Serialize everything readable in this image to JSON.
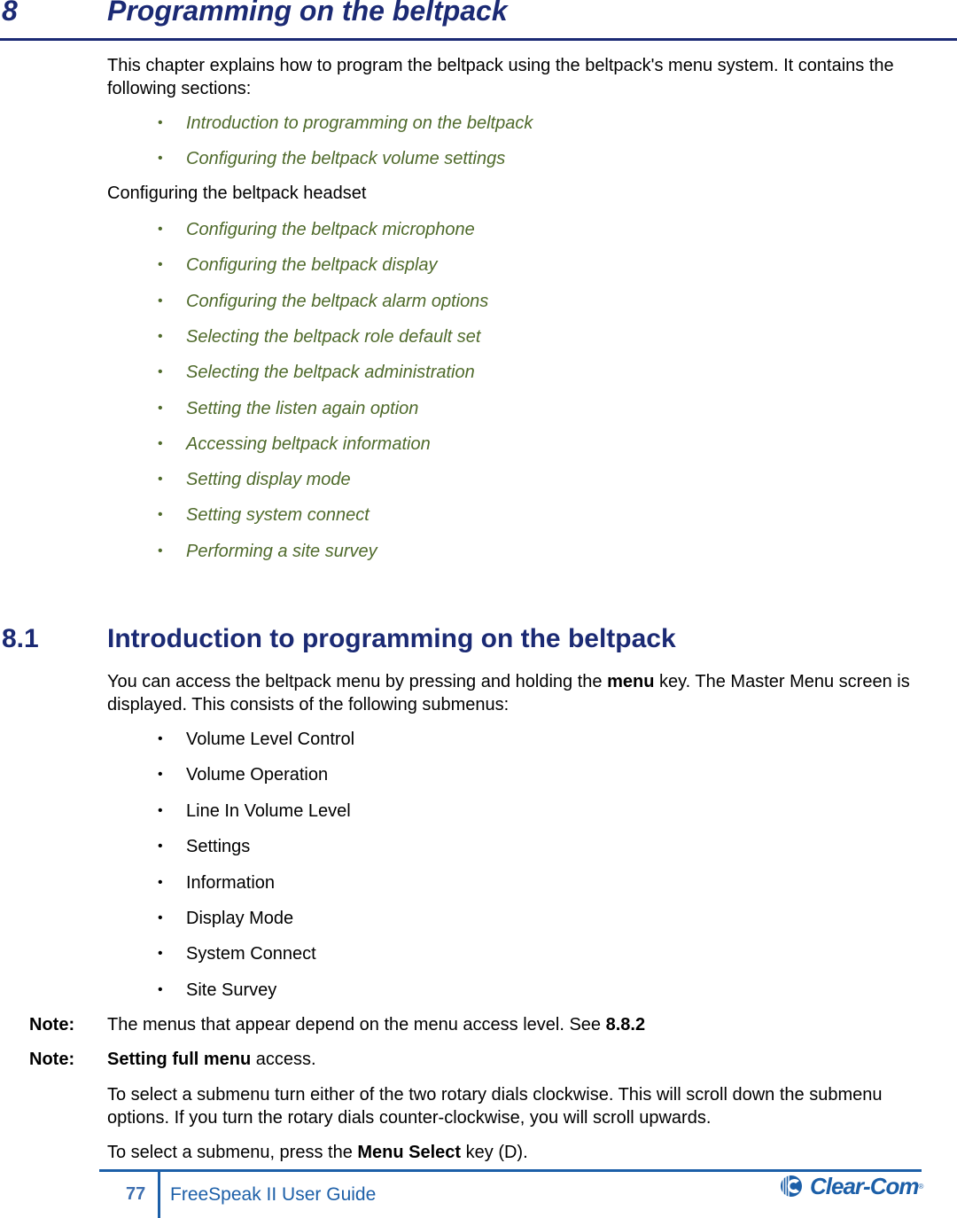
{
  "chapter": {
    "number": "8",
    "title": "Programming on the beltpack",
    "intro": "This chapter explains how to program the beltpack using the beltpack's menu system. It contains the following sections:",
    "sections_a": [
      "Introduction to programming on the beltpack",
      "Configuring the beltpack volume settings"
    ],
    "plain_line": "Configuring the beltpack headset",
    "sections_b": [
      "Configuring the beltpack microphone",
      "Configuring the beltpack display",
      "Configuring the beltpack alarm options",
      "Selecting the beltpack role default set",
      "Selecting the beltpack administration",
      "Setting the listen again option",
      "Accessing beltpack information",
      "Setting display mode",
      "Setting system connect",
      "Performing a site survey"
    ]
  },
  "section": {
    "number": "8.1",
    "title": "Introduction to programming on the beltpack",
    "para1_before": "You can access the beltpack menu by pressing and holding the ",
    "para1_bold": "menu",
    "para1_after": " key. The Master Menu screen is displayed. This consists of the following submenus:",
    "submenus": [
      "Volume Level Control",
      "Volume Operation",
      "Line In Volume Level",
      "Settings",
      "Information",
      "Display Mode",
      "System Connect",
      "Site Survey"
    ],
    "note_label": "Note:",
    "note1_text": "The menus that appear depend on the menu access level. See ",
    "note1_bold": "8.8.2",
    "note2_bold": "Setting full menu",
    "note2_text": " access.",
    "para2": "To select a submenu turn either of the two rotary dials clockwise. This will scroll down the submenu options. If you turn the rotary dials counter-clockwise, you will scroll upwards.",
    "para3_before": "To select a submenu, press the ",
    "para3_bold": "Menu Select",
    "para3_after": " key (D).",
    "bullet_glyph": "•"
  },
  "footer": {
    "page_number": "77",
    "guide_title": "FreeSpeak II User Guide",
    "logo_text": "Clear-Com",
    "logo_reg": "®"
  },
  "colors": {
    "heading": "#1b2a74",
    "link": "#4f6a2b",
    "footer_blue": "#1c5fa8"
  }
}
